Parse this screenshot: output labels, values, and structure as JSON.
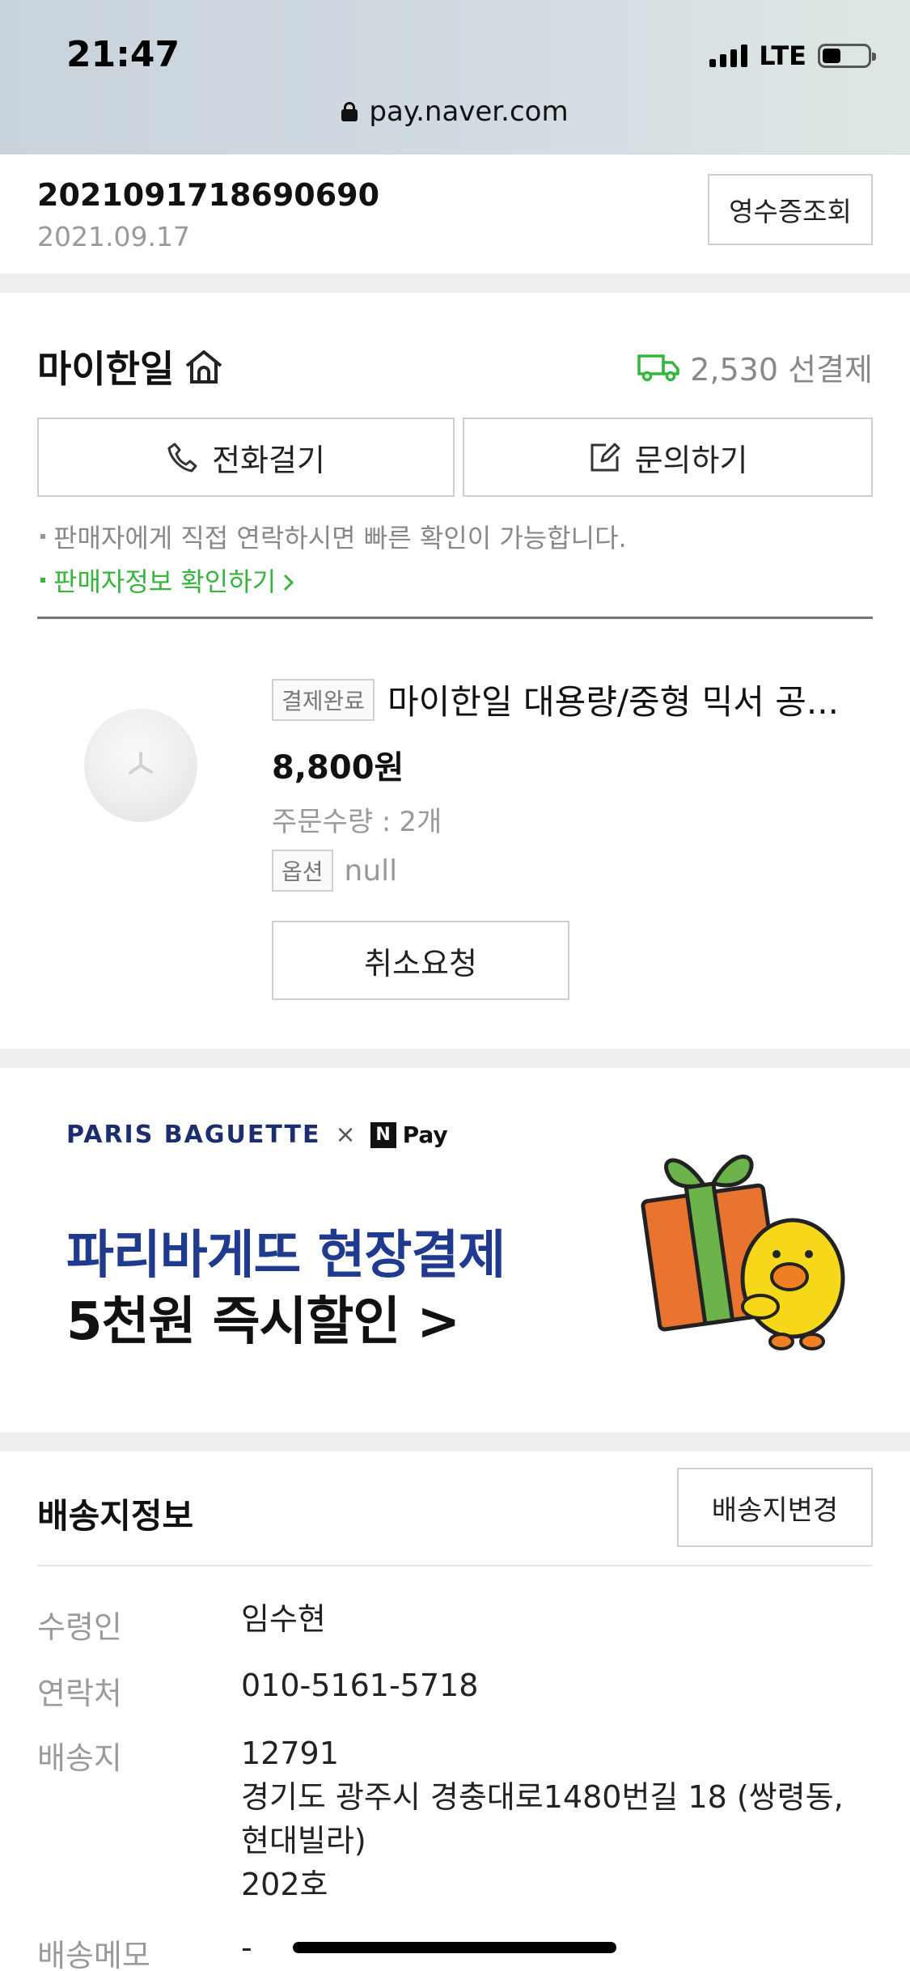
{
  "status_bar": {
    "time": "21:47",
    "network": "LTE",
    "battery_level": 0.4
  },
  "browser": {
    "url": "pay.naver.com"
  },
  "order": {
    "number": "2021091718690690",
    "date": "2021.09.17",
    "receipt_label": "영수증조회"
  },
  "seller": {
    "name": "마이한일",
    "shipping": "2,530 선결제",
    "call_label": "전화걸기",
    "inquiry_label": "문의하기",
    "notice": "판매자에게 직접 연락하시면 빠른 확인이 가능합니다.",
    "info_link": "판매자정보 확인하기"
  },
  "product": {
    "status_badge": "결제완료",
    "title": "마이한일 대용량/중형 믹서 공...",
    "price": "8,800원",
    "qty_label": "주문수량 :",
    "qty_value": "2개",
    "option_badge": "옵션",
    "option_value": "null",
    "cancel_label": "취소요청"
  },
  "banner": {
    "brand": "PARIS BAGUETTE",
    "times": "×",
    "partner": "Pay",
    "partner_mark": "N",
    "headline": "파리바게뜨 현장결제",
    "subline": "5천원 즉시할인 >"
  },
  "delivery": {
    "title": "배송지정보",
    "change_label": "배송지변경",
    "recipient_label": "수령인",
    "recipient": "임수현",
    "contact_label": "연락처",
    "contact": "010-5161-5718",
    "address_label": "배송지",
    "zipcode": "12791",
    "address_line1": "경기도 광주시 경충대로1480번길 18 (쌍령동,",
    "address_line2": "현대빌라)",
    "address_line3": "202호",
    "memo_label": "배송메모",
    "memo": "-"
  },
  "colors": {
    "accent_green": "#35b53e",
    "banner_blue": "#1f3a8f"
  }
}
